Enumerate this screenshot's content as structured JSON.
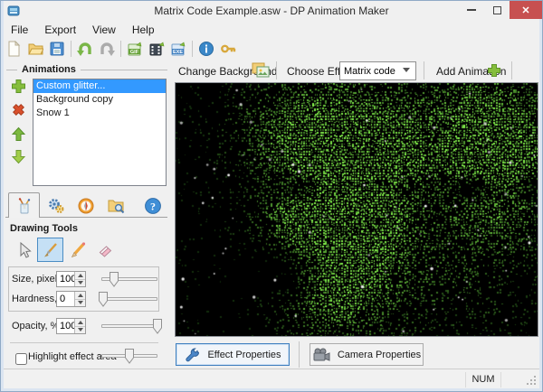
{
  "window": {
    "title": "Matrix Code Example.asw - DP Animation Maker",
    "close_glyph": "✕"
  },
  "menu": {
    "items": [
      "File",
      "Export",
      "View",
      "Help"
    ]
  },
  "toolbar": {
    "icons": [
      "new-document",
      "open-file",
      "save-file",
      "undo",
      "redo",
      "export-gif",
      "export-video",
      "export-exe",
      "info",
      "register-key"
    ],
    "badges": {
      "gif": "GIF",
      "exe": "EXE"
    }
  },
  "animations_panel": {
    "title": "Animations",
    "items": [
      {
        "label": "Custom glitter...",
        "selected": true
      },
      {
        "label": "Background copy",
        "selected": false
      },
      {
        "label": "Snow 1",
        "selected": false
      }
    ]
  },
  "tabs": {
    "icons": [
      "drawing-tools",
      "settings-gears",
      "compass",
      "browse-folder",
      "help"
    ],
    "active": "drawing-tools"
  },
  "drawing_tools": {
    "title": "Drawing Tools",
    "tools": [
      "select-cursor",
      "paintbrush",
      "pencil",
      "eraser"
    ],
    "selected_tool": "paintbrush",
    "size": {
      "label": "Size, pixels:",
      "value": "100",
      "slider_pct": 22
    },
    "hardness": {
      "label": "Hardness, %:",
      "value": "0",
      "slider_pct": 4
    },
    "opacity": {
      "label": "Opacity, %:",
      "value": "100",
      "slider_pct": 100
    },
    "highlight": {
      "label": "Highlight effect area",
      "checked": false,
      "slider_pct": 50
    }
  },
  "effect_bar": {
    "change_background": "Change Background",
    "choose_effect_label": "Choose Effect:",
    "effect_value": "Matrix code",
    "add_animation": "Add Animation"
  },
  "properties_bar": {
    "effect": "Effect Properties",
    "camera": "Camera Properties"
  },
  "status_bar": {
    "num": "NUM"
  },
  "canvas": {
    "effect": "Matrix code dots forming ghostly faces with white snow particles",
    "background": "#000000",
    "green_low": "#102808",
    "green_high": "#7cc84a",
    "snow_color": "#ffffff",
    "snow_dots": 82,
    "seed": 42
  }
}
